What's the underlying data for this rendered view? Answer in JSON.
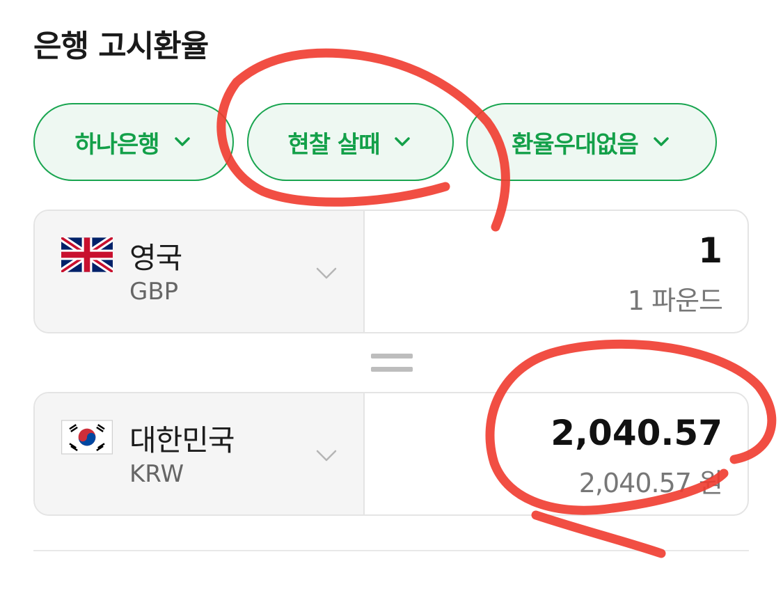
{
  "page": {
    "title": "은행 고시환율"
  },
  "filters": [
    {
      "label": "하나은행"
    },
    {
      "label": "현찰 살때"
    },
    {
      "label": "환율우대없음"
    }
  ],
  "source": {
    "country": "영국",
    "currency_code": "GBP",
    "amount": "1",
    "amount_text": "1 파운드",
    "flag_icon": "uk-flag-icon"
  },
  "target": {
    "country": "대한민국",
    "currency_code": "KRW",
    "amount": "2,040.57",
    "amount_text": "2,040.57 원",
    "flag_icon": "korea-flag-icon"
  },
  "colors": {
    "accent": "#19a550",
    "chip_bg": "#eef8f2",
    "annotation": "#ef3b2f"
  }
}
